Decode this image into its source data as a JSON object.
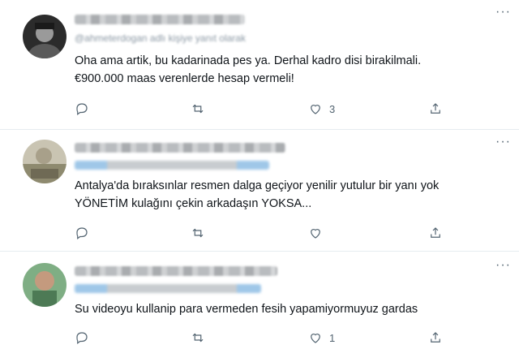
{
  "tweets": [
    {
      "author_name": "Murat K. Erdoğan",
      "author_handle": "@ahmeterdogan adlı kişiye yanıt olarak",
      "lines": [
        "Oha ama artik, bu kadarinada pes ya. Derhal kadro disi birakilmali.",
        "€900.000 maas verenlerde hesap vermeli!"
      ],
      "reply_count": "",
      "retweet_count": "",
      "like_count": "3"
    },
    {
      "author_name": "Kullanıcı",
      "author_handle": "adlı kişiye yanıt olarak",
      "lines": [
        "Antalya'da bıraksınlar resmen dalga geçiyor yenilir yutulur bir yanı yok",
        "YÖNETİM kulağını çekin arkadaşın YOKSA..."
      ],
      "reply_count": "",
      "retweet_count": "",
      "like_count": ""
    },
    {
      "author_name": "Kullanıcı",
      "author_handle": "adlı kişiye yanıt olarak",
      "lines": [
        "Su videoyu kullanip para vermeden fesih yapamiyormuyuz gardas"
      ],
      "reply_count": "",
      "retweet_count": "",
      "like_count": "1"
    }
  ],
  "icons": {
    "reply": "reply-icon",
    "retweet": "retweet-icon",
    "like": "like-icon",
    "share": "share-icon",
    "more": "more-icon"
  },
  "colors": {
    "text": "#0f1419",
    "muted": "#536471",
    "divider": "#e6ecf0",
    "link": "#1d9bf0"
  }
}
